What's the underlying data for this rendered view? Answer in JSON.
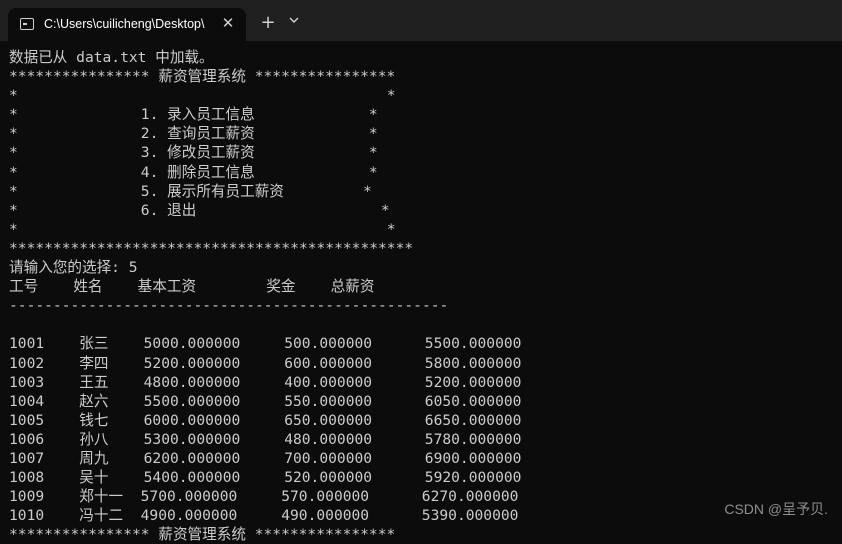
{
  "tab": {
    "title": "C:\\Users\\cuilicheng\\Desktop\\",
    "close": "✕",
    "new_tab": "+"
  },
  "terminal": {
    "lines": [
      "数据已从 data.txt 中加载。",
      "**************** 薪资管理系统 ****************",
      "*                                          *",
      "*              1. 录入员工信息             *",
      "*              2. 查询员工薪资             *",
      "*              3. 修改员工薪资             *",
      "*              4. 删除员工信息             *",
      "*              5. 展示所有员工薪资         *",
      "*              6. 退出                     *",
      "*                                          *",
      "**********************************************",
      "请输入您的选择: 5",
      "工号    姓名    基本工资        奖金    总薪资",
      "--------------------------------------------------",
      "",
      "1001    张三    5000.000000     500.000000      5500.000000",
      "1002    李四    5200.000000     600.000000      5800.000000",
      "1003    王五    4800.000000     400.000000      5200.000000",
      "1004    赵六    5500.000000     550.000000      6050.000000",
      "1005    钱七    6000.000000     650.000000      6650.000000",
      "1006    孙八    5300.000000     480.000000      5780.000000",
      "1007    周九    6200.000000     700.000000      6900.000000",
      "1008    吴十    5400.000000     520.000000      5920.000000",
      "1009    郑十一  5700.000000     570.000000      6270.000000",
      "1010    冯十二  4900.000000     490.000000      5390.000000",
      "**************** 薪资管理系统 ****************"
    ]
  },
  "watermark": "CSDN @呈予贝."
}
